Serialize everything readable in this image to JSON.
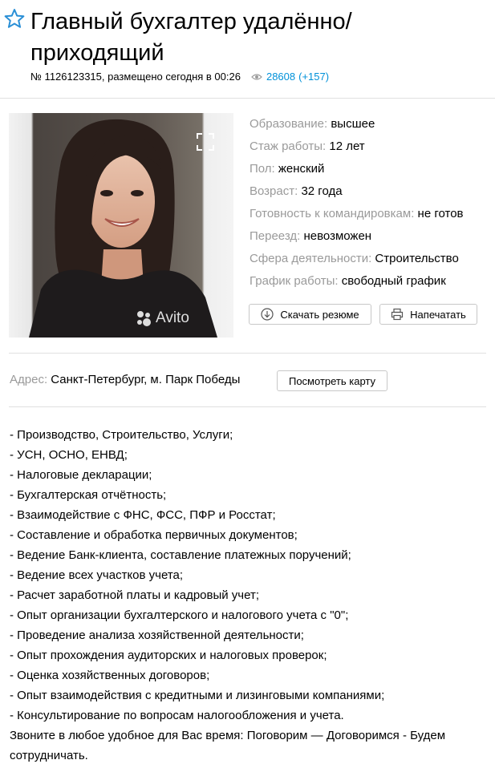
{
  "header": {
    "title": "Главный бухгалтер удалённо/ приходящий",
    "ad_number": "№ 1126123315, размещено сегодня в 00:26",
    "views_total": "28608",
    "views_delta": "(+157)"
  },
  "photo": {
    "watermark": "Avito"
  },
  "params": [
    {
      "key": "Образование:",
      "value": "высшее"
    },
    {
      "key": "Стаж работы:",
      "value": "12 лет"
    },
    {
      "key": "Пол:",
      "value": "женский"
    },
    {
      "key": "Возраст:",
      "value": "32 года"
    },
    {
      "key": "Готовность к командировкам:",
      "value": "не готов"
    },
    {
      "key": "Переезд:",
      "value": "невозможен"
    },
    {
      "key": "Сфера деятельности:",
      "value": "Строительство"
    },
    {
      "key": "График работы:",
      "value": "свободный график"
    }
  ],
  "actions": {
    "download_label": "Скачать резюме",
    "print_label": "Напечатать"
  },
  "address": {
    "key": "Адрес:",
    "value": "Санкт-Петербург, м. Парк Победы",
    "map_button": "Посмотреть карту"
  },
  "description": {
    "lines": [
      "- Производство, Строительство, Услуги;",
      "- УСН, ОСНО, ЕНВД;",
      "- Налоговые декларации;",
      "- Бухгалтерская отчётность;",
      "- Взаимодействие с ФНС, ФСС, ПФР и Росстат;",
      "- Составление и обработка первичных документов;",
      "- Ведение Банк-клиента, составление платежных поручений;",
      "- Ведение всех участков учета;",
      "- Расчет заработной платы и кадровый учет;",
      "- Опыт организации бухгалтерского и налогового учета с \"0\";",
      "- Проведение анализа хозяйственной деятельности;",
      "- Опыт прохождения аудиторских и налоговых проверок;",
      "- Оценка хозяйственных договоров;",
      "- Опыт взаимодействия с кредитными и лизинговыми компаниями;",
      "- Консультирование по вопросам налогообложения и учета."
    ],
    "closing": "Звоните в любое удобное для Вас время: Поговорим — Договоримся - Будем сотрудничать."
  },
  "colors": {
    "link": "#0091d9",
    "label_gray": "#9a9a9a",
    "star_blue": "#2a8fd6"
  },
  "icons": [
    "favorite-star-icon",
    "eye-icon",
    "expand-icon",
    "download-icon",
    "print-icon",
    "avito-logo-icon"
  ]
}
